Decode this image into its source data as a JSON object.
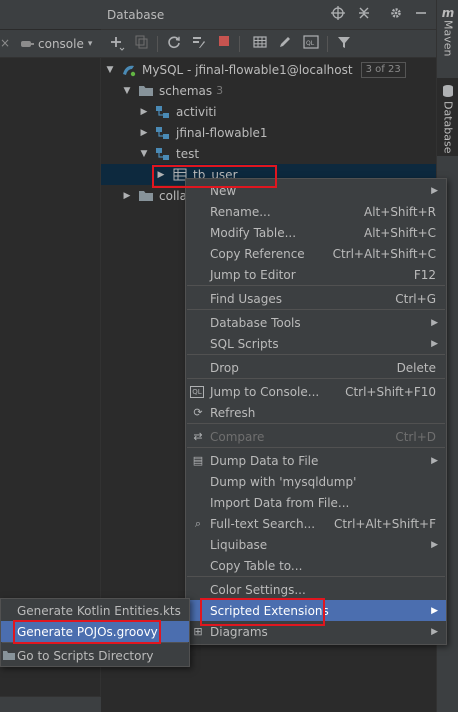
{
  "left_pane": {
    "console_label": "console",
    "close_glyph": "×"
  },
  "database_panel": {
    "title": "Database",
    "header_icons": [
      "crosshair-icon",
      "collapse-icon",
      "gear-icon",
      "hide-icon"
    ],
    "toolbar_icons": [
      "add-icon",
      "copy-icon",
      "refresh-icon",
      "wrench-icon",
      "stop-icon",
      "table-icon",
      "edit-icon",
      "console-icon",
      "filter-icon"
    ]
  },
  "tree": {
    "datasource": {
      "label": "MySQL - jfinal-flowable1@localhost",
      "badge": "3 of 23"
    },
    "schemas": {
      "label": "schemas",
      "count": "3"
    },
    "schema_items": [
      {
        "label": "activiti"
      },
      {
        "label": "jfinal-flowable1"
      },
      {
        "label": "test"
      }
    ],
    "table": {
      "label": "tb_user"
    },
    "collations": {
      "label": "colla"
    }
  },
  "right_stripe": {
    "maven_label": "Maven",
    "database_label": "Database"
  },
  "context_menu": {
    "items": [
      {
        "label": "New",
        "shortcut": "",
        "submenu": true,
        "icon": ""
      },
      {
        "label": "Rename...",
        "shortcut": "Alt+Shift+R",
        "submenu": false,
        "icon": ""
      },
      {
        "label": "Modify Table...",
        "shortcut": "Alt+Shift+C",
        "submenu": false,
        "icon": ""
      },
      {
        "label": "Copy Reference",
        "shortcut": "Ctrl+Alt+Shift+C",
        "submenu": false,
        "icon": ""
      },
      {
        "label": "Jump to Editor",
        "shortcut": "F12",
        "submenu": false,
        "icon": ""
      },
      {
        "label": "Find Usages",
        "shortcut": "Ctrl+G",
        "submenu": false,
        "icon": ""
      },
      {
        "label": "Database Tools",
        "shortcut": "",
        "submenu": true,
        "icon": ""
      },
      {
        "label": "SQL Scripts",
        "shortcut": "",
        "submenu": true,
        "icon": ""
      },
      {
        "label": "Drop",
        "shortcut": "Delete",
        "submenu": false,
        "icon": ""
      },
      {
        "label": "Jump to Console...",
        "shortcut": "Ctrl+Shift+F10",
        "submenu": false,
        "icon": "QL"
      },
      {
        "label": "Refresh",
        "shortcut": "",
        "submenu": false,
        "icon": "⟳"
      },
      {
        "label": "Compare",
        "shortcut": "Ctrl+D",
        "submenu": false,
        "icon": "⇄"
      },
      {
        "label": "Dump Data to File",
        "shortcut": "",
        "submenu": true,
        "icon": "▤"
      },
      {
        "label": "Dump with 'mysqldump'",
        "shortcut": "",
        "submenu": false,
        "icon": ""
      },
      {
        "label": "Import Data from File...",
        "shortcut": "",
        "submenu": false,
        "icon": ""
      },
      {
        "label": "Full-text Search...",
        "shortcut": "Ctrl+Alt+Shift+F",
        "submenu": false,
        "icon": "⌕"
      },
      {
        "label": "Liquibase",
        "shortcut": "",
        "submenu": true,
        "icon": ""
      },
      {
        "label": "Copy Table to...",
        "shortcut": "",
        "submenu": false,
        "icon": ""
      },
      {
        "label": "Color Settings...",
        "shortcut": "",
        "submenu": false,
        "icon": ""
      },
      {
        "label": "Scripted Extensions",
        "shortcut": "",
        "submenu": true,
        "icon": ""
      },
      {
        "label": "Diagrams",
        "shortcut": "",
        "submenu": true,
        "icon": "⊞"
      }
    ]
  },
  "submenu": {
    "items": [
      {
        "label": "Generate Kotlin Entities.kts"
      },
      {
        "label": "Generate POJOs.groovy"
      },
      {
        "label": "Go to Scripts Directory"
      }
    ]
  },
  "colors": {
    "highlight": "#4b6eaf",
    "annotation_red": "#e0161f",
    "selection": "#0d293e"
  }
}
